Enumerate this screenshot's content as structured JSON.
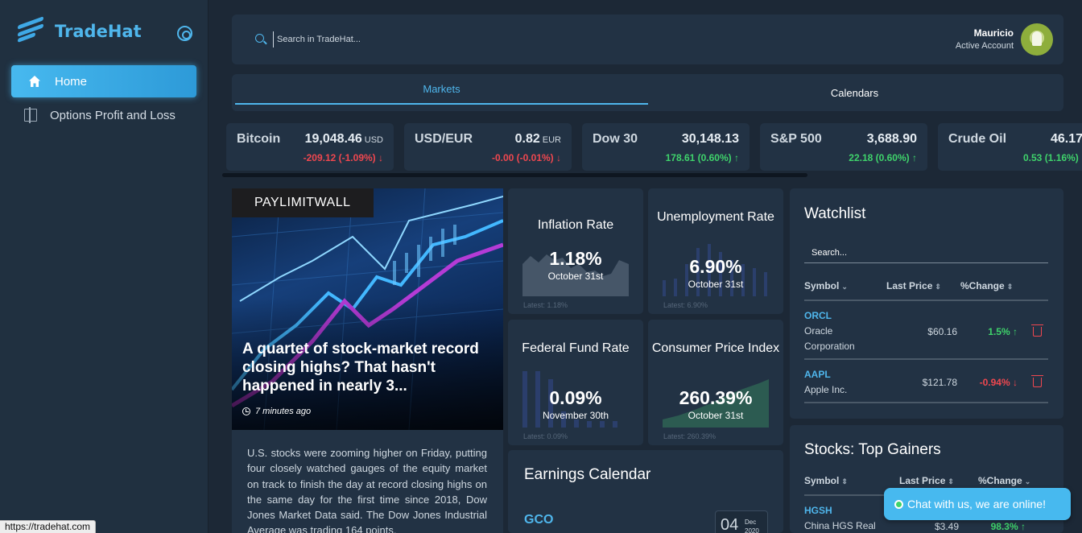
{
  "app": {
    "name": "TradeHat",
    "colors": {
      "accent": "#4fb6ec",
      "positive": "#3fd36b",
      "negative": "#f0474f",
      "background": "#1c2836",
      "panel": "#223244"
    }
  },
  "sidebar": {
    "items": [
      {
        "label": "Home",
        "icon": "home-icon",
        "active": true
      },
      {
        "label": "Options Profit and Loss",
        "icon": "options-icon",
        "active": false
      }
    ]
  },
  "header": {
    "search_placeholder": "Search in TradeHat...",
    "user_name": "Mauricio",
    "user_status": "Active Account"
  },
  "tabs": [
    {
      "label": "Markets",
      "active": true
    },
    {
      "label": "Calendars",
      "active": false
    }
  ],
  "tickers": [
    {
      "name": "Bitcoin",
      "price": "19,048.46",
      "currency": "USD",
      "change": "-209.12 (-1.09%)",
      "direction": "down"
    },
    {
      "name": "USD/EUR",
      "price": "0.82",
      "currency": "EUR",
      "change": "-0.00 (-0.01%)",
      "direction": "down"
    },
    {
      "name": "Dow 30",
      "price": "30,148.13",
      "currency": "",
      "change": "178.61 (0.60%)",
      "direction": "up"
    },
    {
      "name": "S&P 500",
      "price": "3,688.90",
      "currency": "",
      "change": "22.18 (0.60%)",
      "direction": "up"
    },
    {
      "name": "Crude Oil",
      "price": "46.17",
      "currency": "",
      "change": "0.53 (1.16%)",
      "direction": "up"
    }
  ],
  "news": {
    "source": "PAYLIMITWALL",
    "headline": "A quartet of stock-market record closing highs? That hasn't happened in nearly 3...",
    "time": "7 minutes ago",
    "body": "U.S. stocks were zooming higher on Friday, putting four closely watched gauges of the equity market on track to finish the day at record closing highs on the same day for the first time since 2018, Dow Jones Market Data said. The Dow Jones Industrial Average was trading 164 points,"
  },
  "indicators": [
    {
      "title": "Inflation Rate",
      "value": "1.18%",
      "date": "October 31st",
      "latest": "Latest: 1.18%"
    },
    {
      "title": "Unemployment Rate",
      "value": "6.90%",
      "date": "October 31st",
      "latest": "Latest: 6.90%"
    },
    {
      "title": "Federal Fund Rate",
      "value": "0.09%",
      "date": "November 30th",
      "latest": "Latest: 0.09%"
    },
    {
      "title": "Consumer Price Index",
      "value": "260.39%",
      "date": "October 31st",
      "latest": "Latest: 260.39%"
    }
  ],
  "earnings": {
    "title": "Earnings Calendar",
    "first_symbol": "GCO",
    "first_day": "04",
    "first_month": "Dec",
    "first_year": "2020"
  },
  "watchlist": {
    "title": "Watchlist",
    "search_placeholder": "Search...",
    "columns": [
      "Symbol",
      "Last Price",
      "%Change"
    ],
    "rows": [
      {
        "symbol": "ORCL",
        "name": "Oracle Corporation",
        "price": "$60.16",
        "change": "1.5%",
        "direction": "up"
      },
      {
        "symbol": "AAPL",
        "name": "Apple Inc.",
        "price": "$121.78",
        "change": "-0.94%",
        "direction": "down"
      }
    ]
  },
  "gainers": {
    "title": "Stocks: Top Gainers",
    "columns": [
      "Symbol",
      "Last Price",
      "%Change"
    ],
    "rows": [
      {
        "symbol": "HGSH",
        "name": "China HGS Real",
        "price": "$3.49",
        "change": "98.3%",
        "direction": "up"
      }
    ]
  },
  "chat": {
    "label": "Chat with us, we are online!"
  },
  "status_url": "https://tradehat.com"
}
